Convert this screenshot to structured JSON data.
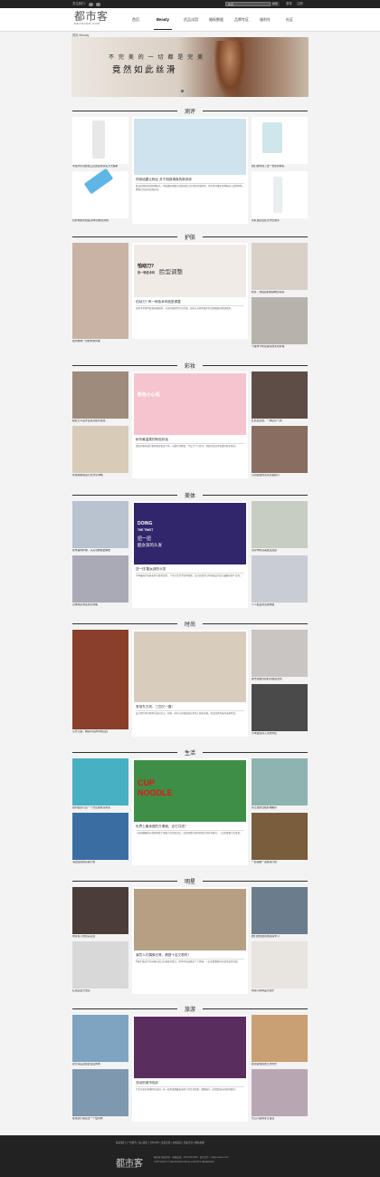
{
  "topbar": {
    "welcome": "关注我们：",
    "search_placeholder": "搜索",
    "search_button": "搜索",
    "login": "登录",
    "register": "注册"
  },
  "header": {
    "logo_cn": "都市客",
    "logo_en": "METROER.COM"
  },
  "nav": [
    "首页",
    "Beauty",
    "优品试用",
    "婚祝数据",
    "品牌专区",
    "福利社",
    "社区"
  ],
  "dropdown": [
    "测评",
    "护肤",
    "彩妆",
    "美体",
    "时尚",
    "生活",
    "明星",
    "旅游"
  ],
  "breadcrumb": "首页>Beauty",
  "banner": {
    "line1": "不 完 美 的 一 切 都 是 完 美",
    "line2": "竟然如此丝滑"
  },
  "sections": [
    {
      "title": "测评",
      "left": [
        {
          "caption": "李佳琦带货绝技口红质感测评实力大解析"
        },
        {
          "caption": "扔掉你的防晒霜,护体新概念防晒"
        }
      ],
      "mid": {
        "title": "热映话题让粉丝 关于肌肤清爽的新测评",
        "body": "欧洲品牌开发的防晒新品，用清透质地配合轻盈肤感让日常防护更简单，本次测评覆盖多种肤质与使用场景，看看它的实际表现如何。"
      },
      "right": [
        {
          "caption": "我们帮你测了这一支新护肤乳"
        },
        {
          "caption": "水乳保湿套装全方位测评"
        }
      ]
    },
    {
      "title": "护肤",
      "left": [
        {
          "caption": "如何整理一身的护肤步骤"
        }
      ],
      "mid": {
        "title": "怕动刀? 有一种技术叫脸型调整",
        "body": "无需手术即可改善轮廓线条，从日常按摩到专业护理，这些方法帮你逐步打造更精致的脸部线条。",
        "banner_a": "怕动刀?",
        "banner_b": "有一种技术叫",
        "banner_c": "脸型调整"
      },
      "right": [
        {
          "caption": "秋冬，熬夜后的肌肤救急指南"
        },
        {
          "caption": "干燥季节修复屏障的关键步骤"
        }
      ]
    },
    {
      "title": "彩妆",
      "left": [
        {
          "caption": "眼影怎么画才显得高级有质感"
        },
        {
          "caption": "化妆刷的挑选与清洁全攻略"
        }
      ],
      "mid": {
        "title": "秋冬最温柔的粉色彩妆",
        "body": "柔和的粉色调让整体妆容更显气色，从腮红到唇妆，学会几个小技巧，轻松打造自然温柔的秋冬妆容。",
        "banner_a": "粉色小心机"
      },
      "right": [
        {
          "caption": "红唇复古妆，一抹就有气场"
        },
        {
          "caption": "闪亮眼妆的派对必备技巧"
        }
      ]
    },
    {
      "title": "美体",
      "left": [
        {
          "caption": "夏季美体护理，从头到脚都要精致"
        },
        {
          "caption": "身体磨砂膏使用全攻略"
        }
      ],
      "mid": {
        "title": "扭一扭 酷女孩的头发",
        "body": "今季最流行的麻花辫与脏辫造型，个性十足又不失时髦感，这几款发型让你轻松成为街头最酷的那个女孩。",
        "banner_a": "DOING",
        "banner_b": "THE TWIST",
        "banner_c": "扭一扭",
        "banner_d": "酷女孩的头发"
      },
      "right": [
        {
          "caption": "派对季的完美发型灵感"
        },
        {
          "caption": "人人都爱的温柔卷发"
        }
      ]
    },
    {
      "title": "时尚",
      "left": [
        {
          "caption": "东方元素，绚丽印花的时尚回归"
        }
      ],
      "mid": {
        "title": "秀场东方风，三四又一春！",
        "body": "设计师们再次将目光投向东方，刺绣、印花与丝绸质感在秀场上纷纷亮相，带来别具韵味的当季时尚。"
      },
      "right": [
        {
          "caption": "都市通勤穿搭的高级感法则"
        },
        {
          "caption": "今季最值得入手的外套"
        }
      ]
    },
    {
      "title": "生活",
      "left": [
        {
          "caption": "如何在家打造一个舒适的健身角落"
        },
        {
          "caption": "海边度假的完美计划"
        }
      ],
      "mid": {
        "title": "世界上最卖座的方便面，合它共进？",
        "body": "一碗热腾腾的方便面承载了无数人的深夜记忆，这款风靡全球的杯面究竟有何魅力，一起来看看它的故事。",
        "banner_a": "CUP",
        "banner_b": "NOODLE"
      },
      "right": [
        {
          "caption": "冬日里的温暖好物推荐"
        },
        {
          "caption": "一起来做一道健康沙拉"
        }
      ]
    },
    {
      "title": "明星",
      "left": [
        {
          "caption": "明星私下的街头造型"
        },
        {
          "caption": "红毯造型大盘点"
        }
      ],
      "mid": {
        "title": "演员人们偶像日常，靓搭十足又很时！",
        "body": "明星们私底下的穿搭往往比红毯更有看点，简单单品混搭出个人风格，一起来看看她们的日常造型灵感。"
      },
      "right": [
        {
          "caption": "她们的街拍风格值得学习"
        },
        {
          "caption": "明星同款单品大搜罗"
        }
      ]
    },
    {
      "title": "旅游",
      "left": [
        {
          "caption": "夏日海岛度假最佳目的地"
        },
        {
          "caption": "在湖边小镇度过一个慢周末"
        }
      ],
      "mid": {
        "title": "流动的城市色彩",
        "body": "行走在色彩斑斓的街道间，每一处角落都藏着当地人的生活故事，跟随镜头一起感受城市的独特魅力。"
      },
      "right": [
        {
          "caption": "欧洲古城里的艺术时光"
        },
        {
          "caption": "雪山小镇的冬日童话"
        }
      ]
    }
  ],
  "footer": {
    "links": "联系我们 | 广告服务 | 加入我们 | 合作伙伴 | 意见反馈 | 友情链接 | 隐私条款 | 网站地图",
    "lines": [
      "都市客 版权所有 · 客服热线：400-000-0000 · 商务合作：bd@metroer.com",
      "COPYRIGHT © METROER.COM ALL RIGHTS RESERVED"
    ],
    "logo_cn": "都市客",
    "logo_en": "METROER.COM"
  }
}
